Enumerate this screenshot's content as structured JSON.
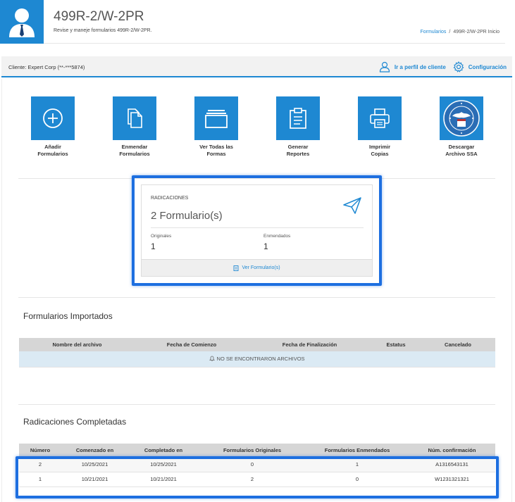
{
  "header": {
    "title": "499R-2/W-2PR",
    "subtitle": "Revise y maneje formularios 499R-2/W-2PR.",
    "breadcrumb": {
      "link": "Formularios",
      "separator": "/",
      "current": "499R-2/W-2PR Inicio"
    }
  },
  "client_bar": {
    "client_label": "Cliente: Expert Corp (**-***5874)",
    "profile_link": "Ir a perfil de cliente",
    "settings_link": "Configuración"
  },
  "tiles": [
    {
      "label_line1": "Añadir",
      "label_line2": "Formularios",
      "icon": "plus-circle-icon"
    },
    {
      "label_line1": "Enmendar",
      "label_line2": "Formularios",
      "icon": "documents-icon"
    },
    {
      "label_line1": "Ver Todas las",
      "label_line2": "Formas",
      "icon": "folder-icon"
    },
    {
      "label_line1": "Generar",
      "label_line2": "Reportes",
      "icon": "clipboard-icon"
    },
    {
      "label_line1": "Imprimir",
      "label_line2": "Copias",
      "icon": "printer-icon"
    },
    {
      "label_line1": "Descargar",
      "label_line2": "Archivo SSA",
      "icon": "ssa-seal-icon"
    }
  ],
  "radicaciones": {
    "title": "RADICACIONES",
    "count": "2 Formulario(s)",
    "originals_label": "Originales",
    "originals_value": "1",
    "amended_label": "Enmendados",
    "amended_value": "1",
    "view_link": "Ver Formulario(s)"
  },
  "imported": {
    "title": "Formularios Importados",
    "columns": [
      "Nombre del archivo",
      "Fecha de Comienzo",
      "Fecha de Finalización",
      "Estatus",
      "Cancelado"
    ],
    "empty_message": "NO SE ENCONTRARON ARCHIVOS"
  },
  "completed": {
    "title": "Radicaciones Completadas",
    "columns": [
      "Número",
      "Comenzado en",
      "Completado en",
      "Formularios Originales",
      "Formularios Enmendados",
      "Núm. confirmación"
    ],
    "rows": [
      [
        "2",
        "10/25/2021",
        "10/25/2021",
        "0",
        "1",
        "A1316543131"
      ],
      [
        "1",
        "10/21/2021",
        "10/21/2021",
        "2",
        "0",
        "W1231321321"
      ]
    ]
  },
  "colors": {
    "accent": "#1e88d2",
    "highlight": "#1d6fe0"
  }
}
